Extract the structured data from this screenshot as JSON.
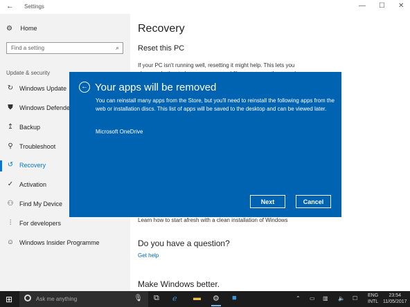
{
  "window": {
    "title": "Settings",
    "back_icon": "back-arrow-icon",
    "minimize": "—",
    "maximize": "☐",
    "close": "✕"
  },
  "sidebar": {
    "home_label": "Home",
    "search_placeholder": "Find a setting",
    "section_label": "Update & security",
    "items": [
      {
        "label": "Windows Update",
        "icon": "sync-icon"
      },
      {
        "label": "Windows Defender",
        "icon": "shield-icon"
      },
      {
        "label": "Backup",
        "icon": "upload-arrow-icon"
      },
      {
        "label": "Troubleshoot",
        "icon": "wrench-icon"
      },
      {
        "label": "Recovery",
        "icon": "history-icon",
        "active": true
      },
      {
        "label": "Activation",
        "icon": "check-circle-icon"
      },
      {
        "label": "Find My Device",
        "icon": "person-device-icon"
      },
      {
        "label": "For developers",
        "icon": "developer-tools-icon"
      },
      {
        "label": "Windows Insider Programme",
        "icon": "insider-icon"
      }
    ]
  },
  "main": {
    "title": "Recovery",
    "reset_heading": "Reset this PC",
    "reset_text_line1": "If your PC isn't running well, resetting it might help. This lets you",
    "reset_text_line2": "choose whether to keep your personal files or remove them, and",
    "fresh_start_link": "Learn how to start afresh with a clean installation of Windows",
    "question_heading": "Do you have a question?",
    "get_help_link": "Get help",
    "better_heading": "Make Windows better."
  },
  "dialog": {
    "title": "Your apps will be removed",
    "body": "You can reinstall many apps from the Store, but you'll need to reinstall the following apps from the web or installation discs. This list of apps will be saved to the desktop and can be viewed later.",
    "apps": [
      "Microsoft OneDrive"
    ],
    "next_label": "Next",
    "cancel_label": "Cancel",
    "background_color": "#0063b1"
  },
  "taskbar": {
    "search_placeholder": "Ask me anything",
    "language_line1": "ENG",
    "language_line2": "INTL",
    "time": "23:54",
    "date": "11/05/2017"
  },
  "colors": {
    "accent": "#0078d7",
    "link": "#0067b8",
    "taskbar": "#1c1c1c"
  }
}
